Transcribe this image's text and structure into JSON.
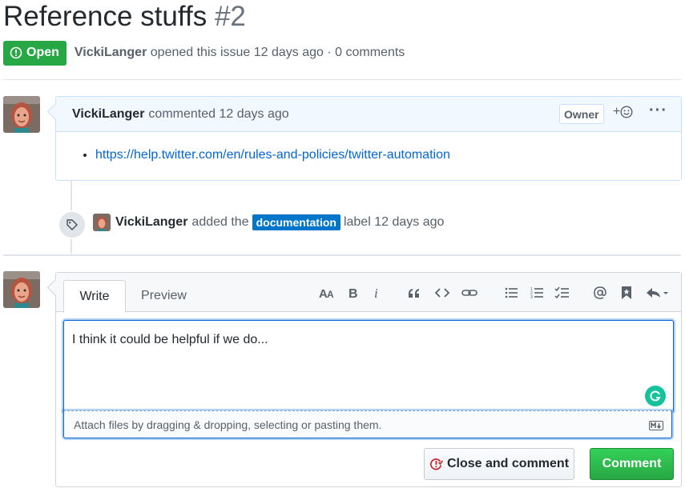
{
  "issue": {
    "title": "Reference stuffs",
    "number": "#2",
    "state": "Open",
    "author": "VickiLanger",
    "meta_text": "opened this issue 12 days ago · 0 comments"
  },
  "comment": {
    "author": "VickiLanger",
    "action": "commented 12 days ago",
    "badge": "Owner",
    "reaction_label": "+",
    "more_label": "···",
    "link": "https://help.twitter.com/en/rules-and-policies/twitter-automation"
  },
  "event": {
    "actor": "VickiLanger",
    "text_before": "added the",
    "label": "documentation",
    "label_color": "#0075ca",
    "text_after": "label 12 days ago"
  },
  "editor": {
    "tabs": [
      "Write",
      "Preview"
    ],
    "toolbar_icons": [
      "text-size-icon",
      "bold-icon",
      "italic-icon",
      "quote-icon",
      "code-icon",
      "link-icon",
      "unordered-list-icon",
      "ordered-list-icon",
      "task-list-icon",
      "mention-icon",
      "saved-reply-icon",
      "reply-arrow-icon"
    ],
    "text": "I think it could be helpful if we do...",
    "attach_hint": "Attach files by dragging & dropping, selecting or pasting them."
  },
  "buttons": {
    "close_comment": "Close and comment",
    "comment": "Comment"
  },
  "colors": {
    "open_green": "#28a745",
    "link_blue": "#0366d6",
    "comment_header_bg": "#f1f8ff"
  }
}
